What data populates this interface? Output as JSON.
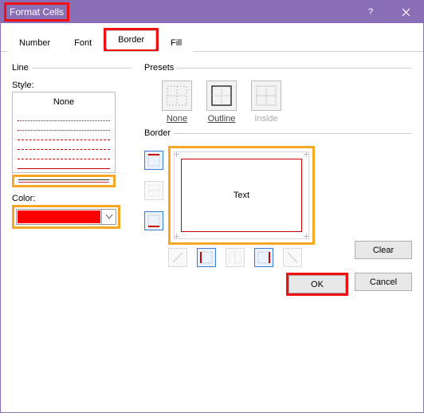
{
  "window": {
    "title": "Format Cells"
  },
  "tabs": [
    "Number",
    "Font",
    "Border",
    "Fill"
  ],
  "line": {
    "group": "Line",
    "styleLabel": "Style:",
    "none": "None",
    "colorLabel": "Color:",
    "colorValue": "#ff0000"
  },
  "presets": {
    "group": "Presets",
    "none": "None",
    "outline": "Outline",
    "inside": "Inside"
  },
  "border": {
    "group": "Border",
    "previewText": "Text"
  },
  "buttons": {
    "clear": "Clear",
    "ok": "OK",
    "cancel": "Cancel"
  }
}
